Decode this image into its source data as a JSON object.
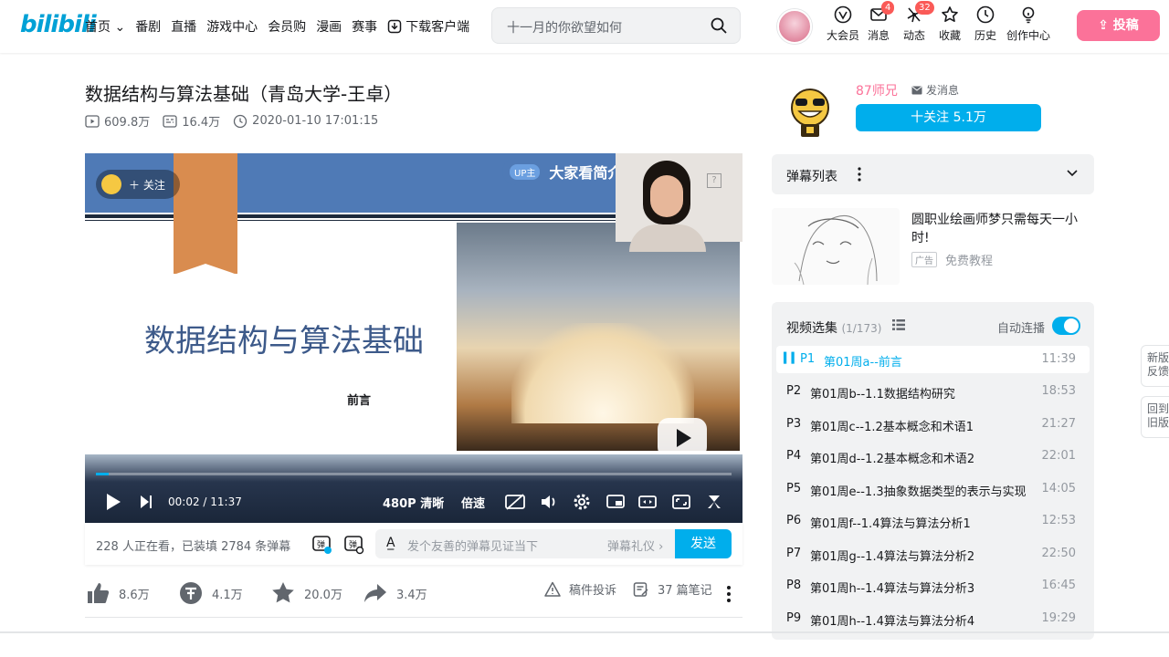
{
  "header": {
    "logo": "bilibili",
    "nav": [
      "首页 ⌄",
      "番剧",
      "直播",
      "游戏中心",
      "会员购",
      "漫画",
      "赛事",
      "下载客户端"
    ],
    "search_placeholder": "十一月的你欲望如何",
    "icons": [
      {
        "label": "大会员",
        "icon": "vip-icon",
        "badge": ""
      },
      {
        "label": "消息",
        "icon": "message-icon",
        "badge": "4"
      },
      {
        "label": "动态",
        "icon": "dynamic-icon",
        "badge": "32"
      },
      {
        "label": "收藏",
        "icon": "favorite-icon",
        "badge": ""
      },
      {
        "label": "历史",
        "icon": "history-icon",
        "badge": ""
      },
      {
        "label": "创作中心",
        "icon": "creator-icon",
        "badge": ""
      }
    ],
    "upload_label": "投稿",
    "accent": "#00aeec",
    "pink": "#fb7299"
  },
  "video": {
    "title": "数据结构与算法基础（青岛大学-王卓）",
    "views": "609.8万",
    "danmaku": "16.4万",
    "date": "2020-01-10 17:01:15"
  },
  "player": {
    "follow_label": "关注",
    "up_tag": "UP主",
    "up_text": "大家看简介",
    "slide_title": "数据结构与算法基础",
    "slide_sub": "前言",
    "time": "00:02 / 11:37",
    "progress": 0.003,
    "quality": "480P 清晰",
    "speed": "倍速"
  },
  "danmaku_bar": {
    "watching": "228 人正在看，已装填 2784 条弹幕",
    "input_placeholder": "发个友善的弹幕见证当下",
    "etiquette": "弹幕礼仪 ›",
    "send": "发送"
  },
  "actions": {
    "like": "8.6万",
    "coin": "4.1万",
    "fav": "20.0万",
    "share": "3.4万",
    "report": "稿件投诉",
    "notes": "37 篇笔记"
  },
  "uploader": {
    "name": "87师兄",
    "message": "发消息",
    "follow": "十关注 5.1万"
  },
  "danmaku_list": {
    "title": "弹幕列表"
  },
  "ad": {
    "title": "圆职业绘画师梦只需每天一小时!",
    "tag": "广告",
    "source": "免费教程"
  },
  "playlist": {
    "title": "视频选集",
    "count": "(1/173)",
    "autoplay": "自动连播",
    "episodes": [
      {
        "p": "P1",
        "name": "第01周a--前言",
        "dur": "11:39"
      },
      {
        "p": "P2",
        "name": "第01周b--1.1数据结构研究",
        "dur": "18:53"
      },
      {
        "p": "P3",
        "name": "第01周c--1.2基本概念和术语1",
        "dur": "21:27"
      },
      {
        "p": "P4",
        "name": "第01周d--1.2基本概念和术语2",
        "dur": "22:01"
      },
      {
        "p": "P5",
        "name": "第01周e--1.3抽象数据类型的表示与实现",
        "dur": "14:05"
      },
      {
        "p": "P6",
        "name": "第01周f--1.4算法与算法分析1",
        "dur": "12:53"
      },
      {
        "p": "P7",
        "name": "第01周g--1.4算法与算法分析2",
        "dur": "22:50"
      },
      {
        "p": "P8",
        "name": "第01周h--1.4算法与算法分析3",
        "dur": "16:45"
      },
      {
        "p": "P9",
        "name": "第01周h--1.4算法与算法分析4",
        "dur": "19:29"
      }
    ]
  },
  "side": {
    "feedback": "新版反馈",
    "oldver": "回到旧版"
  }
}
